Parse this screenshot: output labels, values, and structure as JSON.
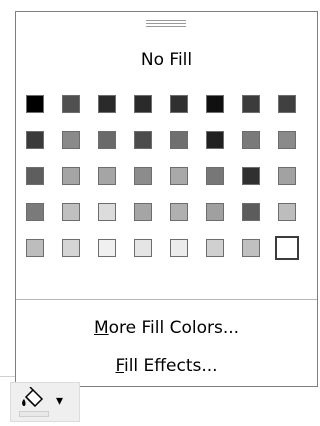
{
  "menu": {
    "no_fill_label": "No Fill",
    "more_fill_colors_label": "More Fill Colors...",
    "more_fill_colors_access_key": "M",
    "fill_effects_label": "Fill Effects...",
    "fill_effects_access_key": "F"
  },
  "swatch_rows": [
    [
      "#000000",
      "#505050",
      "#2a2a2a",
      "#2a2a2a",
      "#303030",
      "#101010",
      "#3c3c3c",
      "#404040"
    ],
    [
      "#3a3a3a",
      "#8a8a8a",
      "#6a6a6a",
      "#4c4c4c",
      "#6f6f6f",
      "#202020",
      "#7a7a7a",
      "#8a8a8a"
    ],
    [
      "#5e5e5e",
      "#a5a5a5",
      "#a5a5a5",
      "#8c8c8c",
      "#a9a9a9",
      "#777777",
      "#303030",
      "#a2a2a2"
    ],
    [
      "#7a7a7a",
      "#c0c0c0",
      "#dcdcdc",
      "#a5a5a5",
      "#b0b0b0",
      "#a0a0a0",
      "#5c5c5c",
      "#bdbdbd"
    ],
    [
      "#bdbdbd",
      "#d5d5d5",
      "#f0f0f0",
      "#e5e5e5",
      "#ececec",
      "#d0d0d0",
      "#c0c0c0",
      "#ffffff"
    ]
  ],
  "selected_swatch": {
    "row": 4,
    "col": 7
  },
  "toolbar": {
    "fill_button_icon": "paint-bucket-icon",
    "dropdown_icon": "down-arrow-icon"
  }
}
